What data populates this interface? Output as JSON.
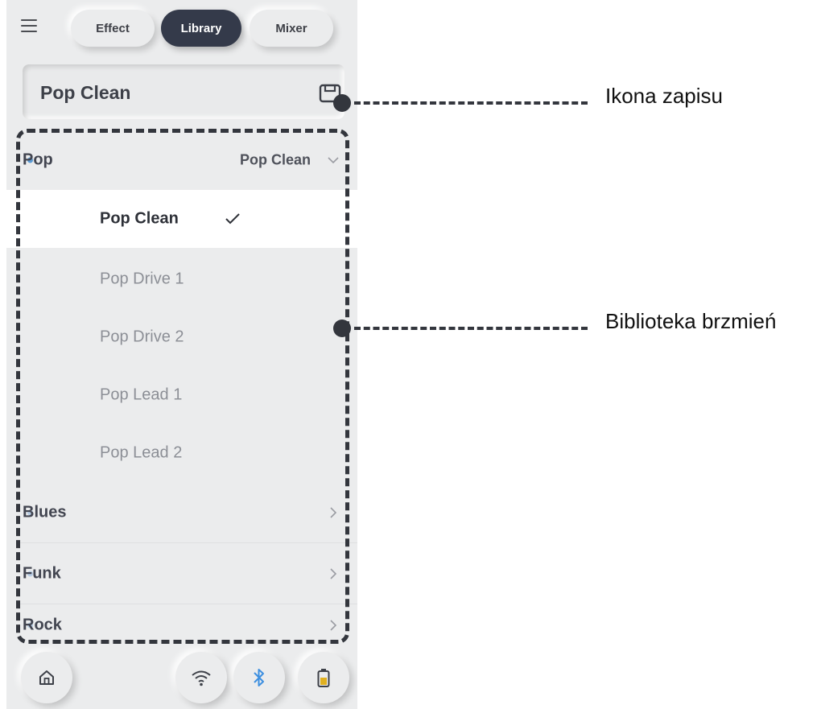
{
  "header": {
    "tabs": [
      {
        "label": "Effect",
        "active": false
      },
      {
        "label": "Library",
        "active": true
      },
      {
        "label": "Mixer",
        "active": false
      }
    ]
  },
  "preset": {
    "name": "Pop Clean"
  },
  "library": {
    "pop": {
      "label": "Pop",
      "current": "Pop Clean",
      "items": [
        "Pop Clean",
        "Pop Drive 1",
        "Pop Drive 2",
        "Pop Lead 1",
        "Pop Lead 2"
      ]
    },
    "blues": {
      "label": "Blues"
    },
    "funk": {
      "label": "Funk"
    },
    "rock": {
      "label": "Rock"
    }
  },
  "callouts": {
    "save": "Ikona zapisu",
    "library": "Biblioteka brzmień"
  },
  "icons": [
    "menu-icon",
    "save-icon",
    "check-icon",
    "chevron-down-icon",
    "chevron-right-icon",
    "home-icon",
    "wifi-icon",
    "bluetooth-icon",
    "battery-icon"
  ],
  "colors": {
    "active_tab": "#343a4a",
    "background": "#ebeced",
    "selected_row": "#ffffff",
    "accent_dot": "#5b9bd5",
    "bluetooth": "#3d8fe0",
    "battery": "#e0b020",
    "callout": "#33363d"
  }
}
